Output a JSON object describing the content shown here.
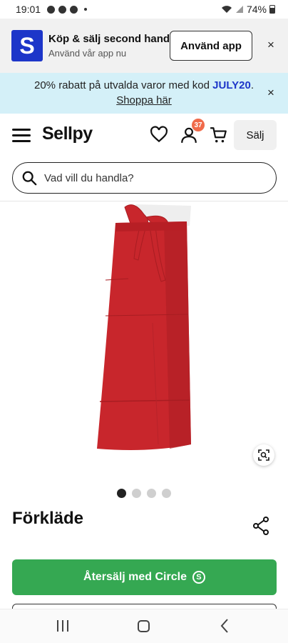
{
  "status": {
    "time": "19:01",
    "battery": "74%"
  },
  "app_banner": {
    "logo_letter": "S",
    "title": "Köp & sälj second hand",
    "subtitle": "Använd vår app nu",
    "button": "Använd app",
    "close": "×"
  },
  "promo": {
    "text": "20% rabatt på utvalda varor med kod ",
    "code": "JULY20",
    "period": ".",
    "link": "Shoppa här",
    "close": "×"
  },
  "header": {
    "logo": "Sellpy",
    "badge_count": "37",
    "sell": "Sälj"
  },
  "search": {
    "placeholder": "Vad vill du handla?"
  },
  "product": {
    "title": "Förkläde",
    "image_count": 4,
    "active_image": 1,
    "resell_label": "Återsälj med Circle",
    "circle_logo": "S"
  },
  "colors": {
    "brand_blue": "#1d36c9",
    "promo_bg": "#d4f0f8",
    "badge": "#f06a4a",
    "resell_green": "#35a852",
    "apron_red": "#c8262c"
  },
  "icons": [
    "settings-icon",
    "messenger-icon",
    "wifi-icon",
    "signal-icon",
    "battery-icon",
    "heart-icon",
    "user-icon",
    "cart-icon",
    "search-icon",
    "zoom-icon",
    "share-icon"
  ]
}
